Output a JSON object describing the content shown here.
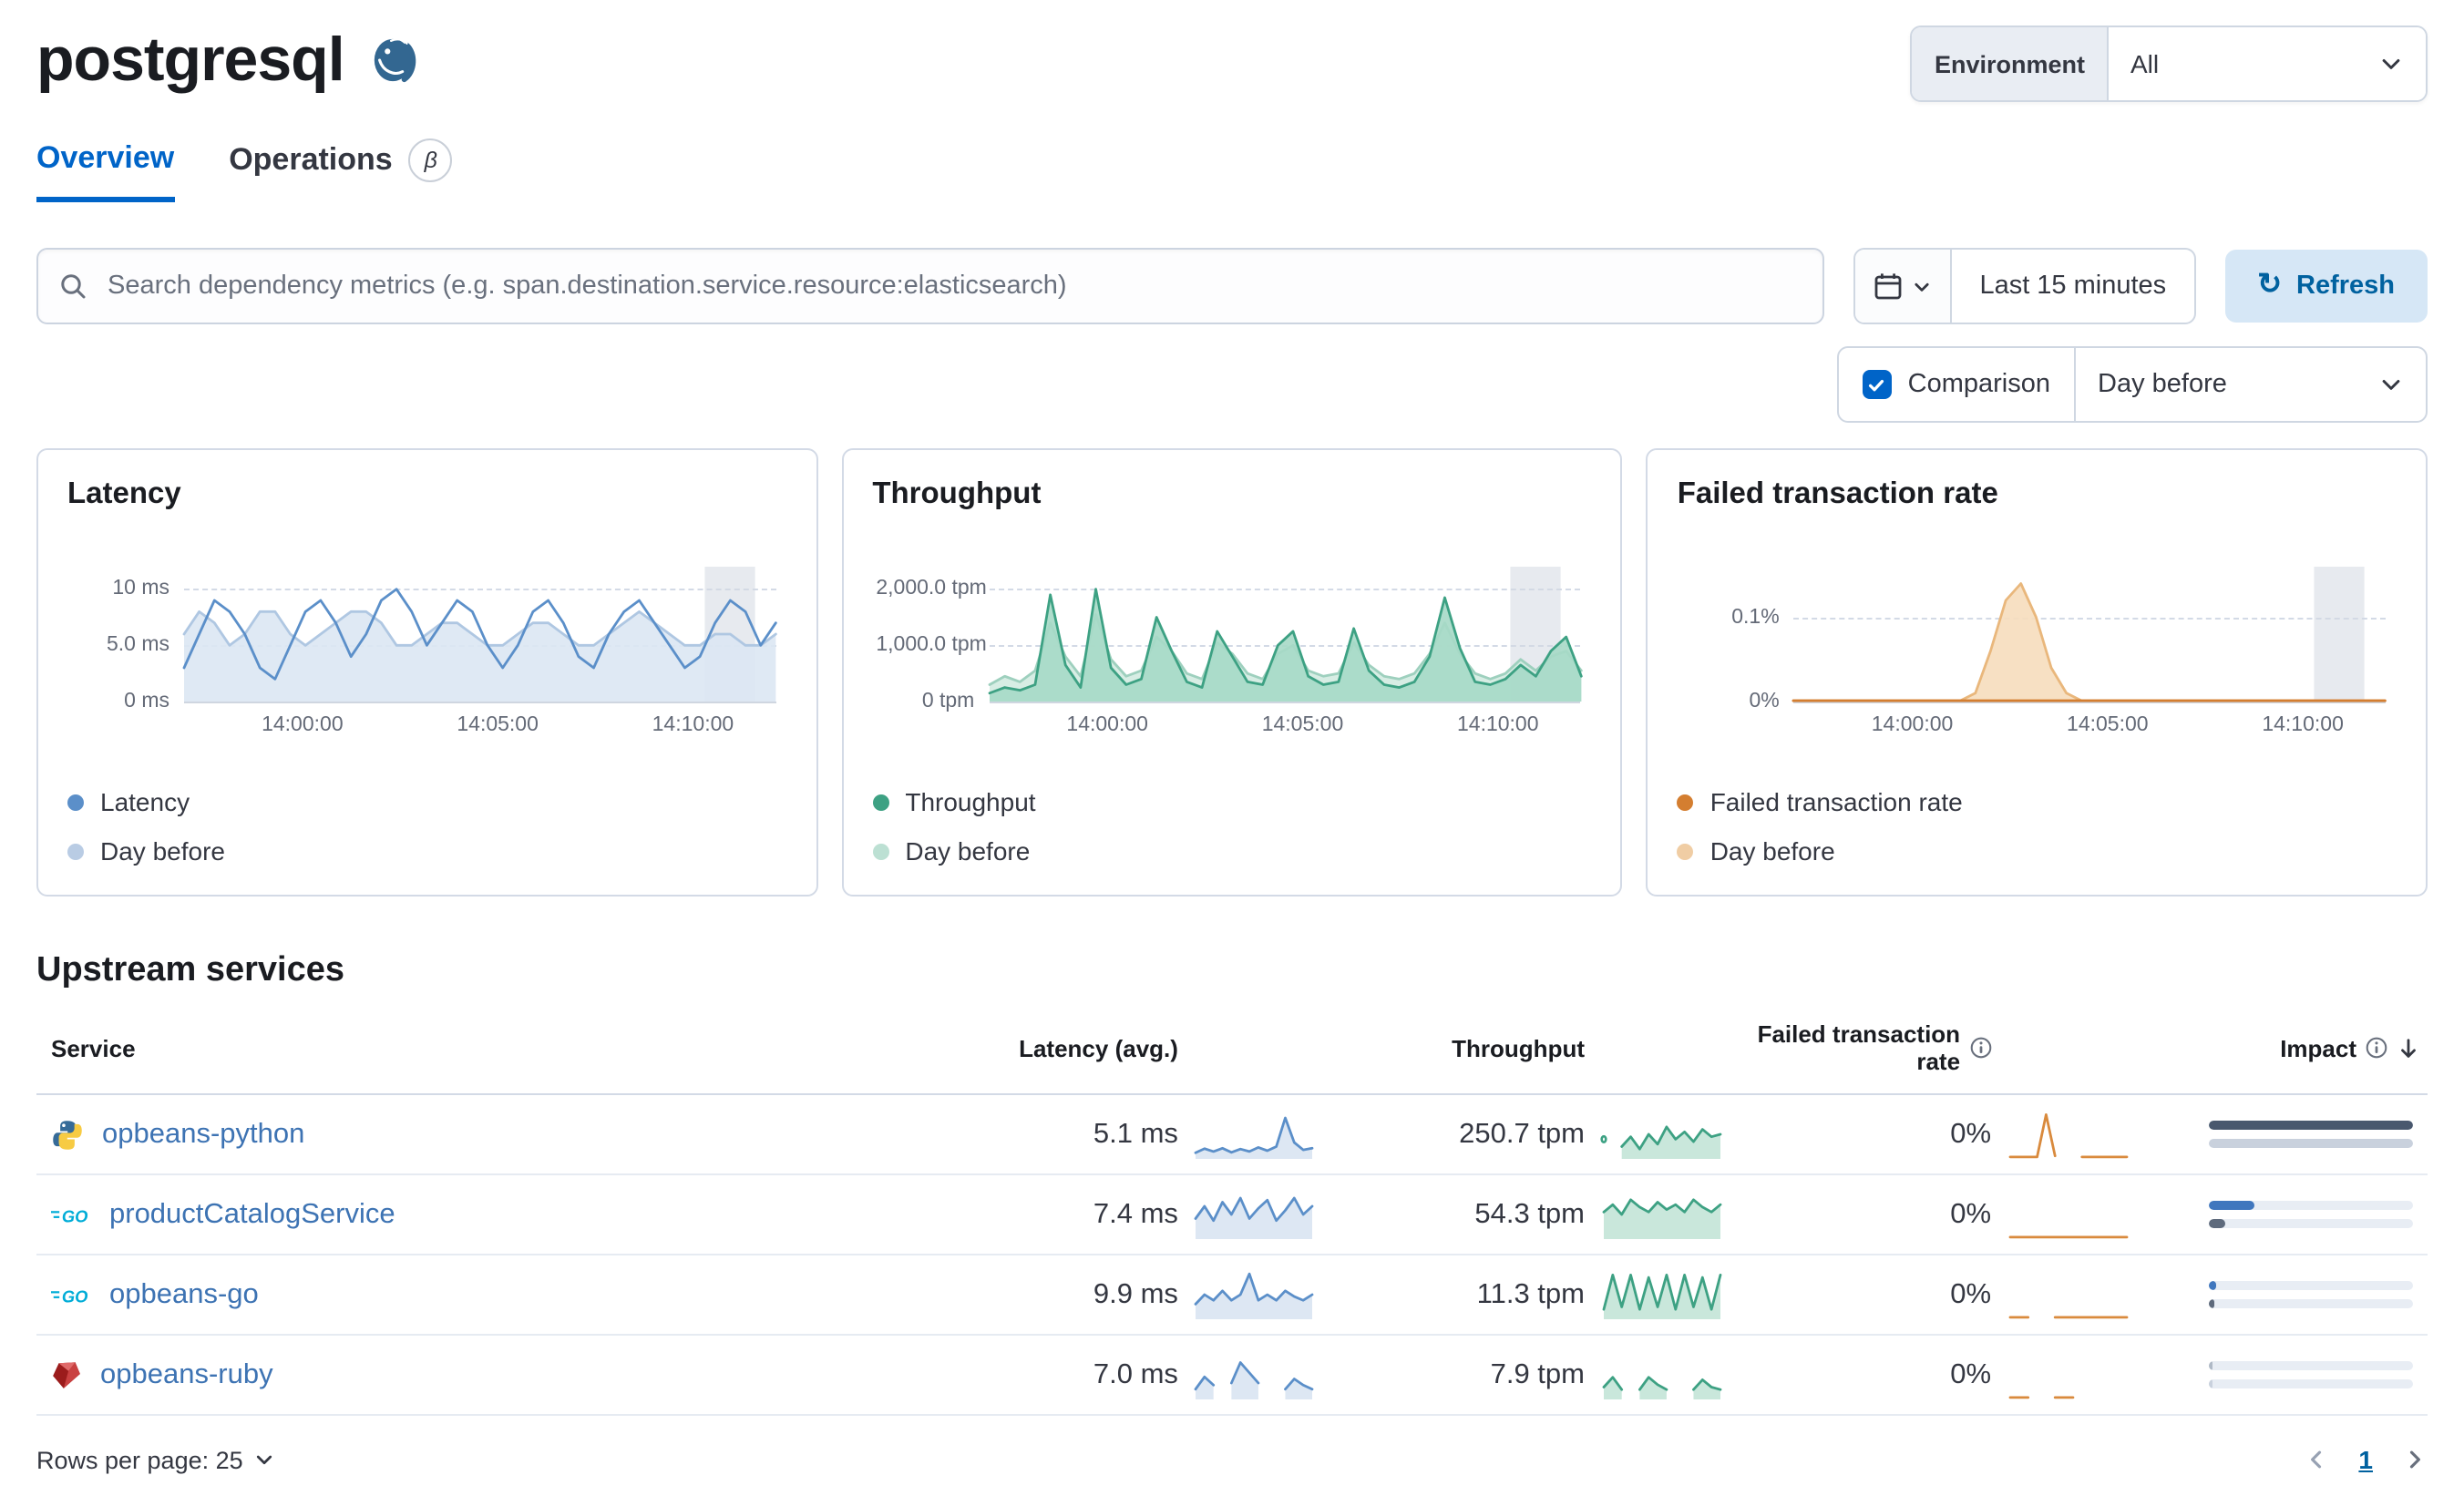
{
  "colors": {
    "accent": "#0064C8",
    "link": "#3D73B3",
    "panel_border": "#D3DAE6"
  },
  "header": {
    "title": "postgresql",
    "environment_label": "Environment",
    "environment_value": "All"
  },
  "tabs": [
    {
      "label": "Overview",
      "active": true
    },
    {
      "label": "Operations",
      "beta": "β"
    }
  ],
  "toolbar": {
    "search_placeholder": "Search dependency metrics (e.g. span.destination.service.resource:elasticsearch)",
    "time_range": "Last 15 minutes",
    "refresh_label": "Refresh",
    "comparison_label": "Comparison",
    "comparison_value": "Day before"
  },
  "charts": [
    {
      "type": "line",
      "title": "Latency",
      "ymax": 12,
      "ticks": [
        {
          "label": "10 ms",
          "value": 10
        },
        {
          "label": "5.0 ms",
          "value": 5
        },
        {
          "label": "0 ms",
          "value": 0
        }
      ],
      "x_ticks": [
        "14:00:00",
        "14:05:00",
        "14:10:00"
      ],
      "legend": [
        {
          "label": "Latency",
          "color": "#5B8FC9"
        },
        {
          "label": "Day before",
          "color": "#B9CCE4"
        }
      ],
      "band": {
        "x0": 88,
        "x1": 96.5
      },
      "series": [
        {
          "name": "Day before",
          "line": "#AFC7E2",
          "fill": "#DCE7F3",
          "values": [
            6,
            8,
            7,
            5,
            6,
            8,
            8,
            6,
            5,
            6,
            7,
            8,
            8,
            7,
            5,
            5,
            6,
            7,
            7,
            6,
            5,
            5,
            6,
            7,
            7,
            6,
            5,
            5,
            6,
            7,
            8,
            7,
            6,
            5,
            5,
            6,
            6,
            5,
            5,
            6
          ]
        },
        {
          "name": "Latency",
          "line": "#5B8FC9",
          "fill": null,
          "values": [
            3,
            6,
            9,
            8,
            6,
            3,
            2,
            5,
            8,
            9,
            7,
            4,
            6,
            9,
            10,
            8,
            5,
            7,
            9,
            8,
            5,
            3,
            5,
            8,
            9,
            7,
            4,
            3,
            6,
            8,
            9,
            7,
            5,
            3,
            4,
            7,
            9,
            8,
            5,
            7
          ]
        }
      ]
    },
    {
      "type": "area",
      "title": "Throughput",
      "ymax": 2400,
      "ticks": [
        {
          "label": "2,000.0 tpm",
          "value": 2000
        },
        {
          "label": "1,000.0 tpm",
          "value": 1000
        },
        {
          "label": "0 tpm",
          "value": 0
        }
      ],
      "x_ticks": [
        "14:00:00",
        "14:05:00",
        "14:10:00"
      ],
      "legend": [
        {
          "label": "Throughput",
          "color": "#3DA183"
        },
        {
          "label": "Day before",
          "color": "#BCE0D3"
        }
      ],
      "band": {
        "x0": 88,
        "x1": 96.5
      },
      "series": [
        {
          "name": "Day before",
          "line": "#9ED0BE",
          "fill": "#D3EBE1",
          "values": [
            300,
            450,
            350,
            550,
            1400,
            800,
            450,
            1550,
            750,
            450,
            550,
            1150,
            900,
            500,
            400,
            1050,
            850,
            500,
            400,
            850,
            1000,
            550,
            450,
            500,
            1050,
            650,
            450,
            400,
            500,
            850,
            1400,
            850,
            500,
            400,
            500,
            750,
            550,
            800,
            900,
            550
          ]
        },
        {
          "name": "Throughput",
          "line": "#3DA183",
          "fill": "#A6D9C6",
          "values": [
            150,
            250,
            200,
            300,
            1900,
            650,
            250,
            2000,
            600,
            300,
            400,
            1500,
            900,
            350,
            250,
            1250,
            800,
            350,
            300,
            1000,
            1250,
            450,
            300,
            350,
            1300,
            550,
            300,
            250,
            350,
            800,
            1850,
            950,
            350,
            300,
            400,
            650,
            450,
            900,
            1150,
            450
          ]
        }
      ]
    },
    {
      "type": "area",
      "title": "Failed transaction rate",
      "ymax": 0.16,
      "ticks": [
        {
          "label": "0.1%",
          "value": 0.1
        },
        {
          "label": "0%",
          "value": 0
        }
      ],
      "x_ticks": [
        "14:00:00",
        "14:05:00",
        "14:10:00"
      ],
      "legend": [
        {
          "label": "Failed transaction rate",
          "color": "#D47E30"
        },
        {
          "label": "Day before",
          "color": "#F0CDA4"
        }
      ],
      "band": {
        "x0": 88,
        "x1": 96.5
      },
      "series": [
        {
          "name": "Day before",
          "line": "#E9B77C",
          "fill": "#F6DDBD",
          "values": [
            0.001,
            0.001,
            0.001,
            0.001,
            0.001,
            0.001,
            0.001,
            0.001,
            0.001,
            0.001,
            0.001,
            0.001,
            0.01,
            0.06,
            0.12,
            0.14,
            0.1,
            0.04,
            0.01,
            0.001,
            0.001,
            0.001,
            0.001,
            0.001,
            0.001,
            0.001,
            0.001,
            0.001,
            0.001,
            0.001,
            0.001,
            0.001,
            0.001,
            0.001,
            0.001,
            0.001,
            0.001,
            0.001,
            0.001,
            0.001
          ]
        },
        {
          "name": "Failed transaction rate",
          "line": "#D47E30",
          "fill": null,
          "values": [
            0.001,
            0.001,
            0.001,
            0.001,
            0.001,
            0.001,
            0.001,
            0.001,
            0.001,
            0.001,
            0.001,
            0.001,
            0.001,
            0.001,
            0.001,
            0.001,
            0.001,
            0.001,
            0.001,
            0.001,
            0.001,
            0.001,
            0.001,
            0.001,
            0.001,
            0.001,
            0.001,
            0.001,
            0.001,
            0.001,
            0.001,
            0.001,
            0.001,
            0.001,
            0.001,
            0.001,
            0.001,
            0.001,
            0.001,
            0.001
          ]
        }
      ]
    }
  ],
  "table": {
    "section_title": "Upstream services",
    "columns": [
      {
        "label": "Service"
      },
      {
        "label": "Latency (avg.)"
      },
      {
        "label": "Throughput"
      },
      {
        "label": "Failed transaction rate",
        "info": true
      },
      {
        "label": "Impact",
        "info": true,
        "sorted": "desc"
      }
    ],
    "rows": [
      {
        "service": "opbeans-python",
        "icon": "python",
        "latency": "5.1 ms",
        "throughput": "250.7 tpm",
        "failed_rate": "0%",
        "latency_spark": {
          "max": 12,
          "line": "#5B8FC9",
          "fill": "#D9E4F2",
          "values": [
            1.5,
            2.5,
            1.8,
            2.6,
            1.6,
            2.4,
            1.8,
            2.8,
            2,
            3,
            10,
            4,
            2.2,
            2.6
          ]
        },
        "throughput_spark": {
          "max": 10,
          "line": "#3DA183",
          "fill": "#C3E4D7",
          "values": [
            4,
            null,
            2.5,
            4.5,
            2,
            5,
            3,
            6.5,
            4,
            5.5,
            3.5,
            6,
            4.5,
            5
          ]
        },
        "failed_spark": {
          "max": 10,
          "line": "#D98A3D",
          "fill": null,
          "values": [
            0.4,
            0.4,
            0.4,
            0.4,
            9,
            0.6,
            null,
            null,
            0.4,
            0.4,
            0.4,
            0.4,
            0.4,
            0.4
          ]
        },
        "impact": {
          "current": {
            "pct": 100,
            "color": "#49586E"
          },
          "previous": {
            "pct": 100,
            "color": "#C9D1DD"
          }
        }
      },
      {
        "service": "productCatalogService",
        "icon": "go",
        "latency": "7.4 ms",
        "throughput": "54.3 tpm",
        "failed_rate": "0%",
        "latency_spark": {
          "max": 12,
          "line": "#5B8FC9",
          "fill": "#D9E4F2",
          "values": [
            5,
            8,
            4.5,
            9,
            6,
            10,
            5,
            7.5,
            9.5,
            4.5,
            7,
            10,
            6,
            8
          ]
        },
        "throughput_spark": {
          "max": 10,
          "line": "#3DA183",
          "fill": "#C3E4D7",
          "values": [
            5.5,
            7,
            5,
            8,
            6.5,
            5.5,
            7.5,
            6,
            7,
            5.5,
            8,
            6.5,
            5.5,
            7
          ]
        },
        "failed_spark": {
          "max": 10,
          "line": "#D98A3D",
          "fill": null,
          "values": [
            0.4,
            0.4,
            0.4,
            0.4,
            0.4,
            0.4,
            0.4,
            0.4,
            0.4,
            0.4,
            0.4,
            0.4,
            0.4,
            0.4
          ]
        },
        "impact": {
          "current": {
            "pct": 22,
            "color": "#4077BE"
          },
          "previous": {
            "pct": 8,
            "color": "#5E6A7C"
          }
        }
      },
      {
        "service": "opbeans-go",
        "icon": "go",
        "latency": "9.9 ms",
        "throughput": "11.3 tpm",
        "failed_rate": "0%",
        "latency_spark": {
          "max": 13,
          "line": "#5B8FC9",
          "fill": "#D9E4F2",
          "values": [
            4,
            6.5,
            5,
            7.5,
            5,
            6.5,
            12,
            5,
            6.5,
            5,
            7.5,
            6,
            5,
            6.5
          ]
        },
        "throughput_spark": {
          "max": 10,
          "line": "#3DA183",
          "fill": "#C3E4D7",
          "values": [
            2,
            9,
            2.5,
            9,
            2,
            8.5,
            2.5,
            9,
            2,
            9,
            2.5,
            8.5,
            2,
            9
          ]
        },
        "failed_spark": {
          "max": 10,
          "line": "#D98A3D",
          "fill": null,
          "values": [
            0.4,
            0.4,
            0.4,
            null,
            null,
            0.4,
            0.4,
            0.4,
            0.4,
            0.4,
            0.4,
            0.4,
            0.4,
            0.4
          ]
        },
        "impact": {
          "current": {
            "pct": 4,
            "color": "#4077BE"
          },
          "previous": {
            "pct": 3,
            "color": "#5E6A7C"
          }
        }
      },
      {
        "service": "opbeans-ruby",
        "icon": "ruby",
        "latency": "7.0 ms",
        "throughput": "7.9 tpm",
        "failed_rate": "0%",
        "latency_spark": {
          "max": 12,
          "line": "#5B8FC9",
          "fill": "#D9E4F2",
          "values": [
            2.5,
            5.5,
            3.5,
            null,
            4,
            9,
            6.5,
            4,
            null,
            null,
            2.5,
            5,
            3.5,
            2.5
          ]
        },
        "throughput_spark": {
          "max": 10,
          "line": "#3DA183",
          "fill": "#C3E4D7",
          "values": [
            2.5,
            4.5,
            2,
            null,
            2,
            4.5,
            3,
            2,
            null,
            null,
            2,
            4,
            2.5,
            2
          ]
        },
        "failed_spark": {
          "max": 10,
          "line": "#D98A3D",
          "fill": null,
          "values": [
            0.4,
            0.4,
            0.4,
            null,
            null,
            0.4,
            0.4,
            0.4,
            null,
            null,
            null,
            null,
            null,
            null
          ]
        },
        "impact": {
          "current": {
            "pct": 2,
            "color": "#AFB9C6"
          },
          "previous": {
            "pct": 2,
            "color": "#C9D1DD"
          }
        }
      }
    ],
    "footer": {
      "rows_per_page": "Rows per page: 25",
      "page": "1"
    }
  }
}
